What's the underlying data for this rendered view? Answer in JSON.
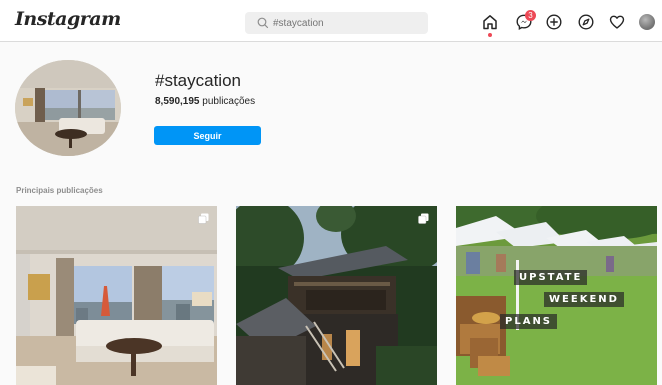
{
  "header": {
    "logo_text": "Instagram",
    "search": {
      "placeholder": "#staycation",
      "icon": "search-icon"
    },
    "nav": [
      {
        "name": "home-icon"
      },
      {
        "name": "messenger-icon",
        "badge": "3"
      },
      {
        "name": "new-post-icon"
      },
      {
        "name": "explore-icon"
      },
      {
        "name": "activity-heart-icon"
      },
      {
        "name": "profile-avatar"
      }
    ]
  },
  "hashtag": {
    "title": "#staycation",
    "post_count": "8,590,195",
    "post_count_label": "publicações",
    "follow_label": "Seguir"
  },
  "top_posts": {
    "label": "Principais publicações",
    "posts": [
      {
        "kind": "hotel-room-tokyo-view",
        "multiple": true
      },
      {
        "kind": "cabin-in-forest",
        "multiple": true
      },
      {
        "kind": "market-tents-on-grass",
        "multiple": false,
        "overlay_words": [
          "UPSTATE",
          "WEEKEND",
          "PLANS"
        ]
      }
    ]
  },
  "colors": {
    "accent": "#0095f6",
    "notification": "#ed4956",
    "text": "#262626",
    "muted": "#8e8e8e",
    "background": "#fafafa"
  }
}
